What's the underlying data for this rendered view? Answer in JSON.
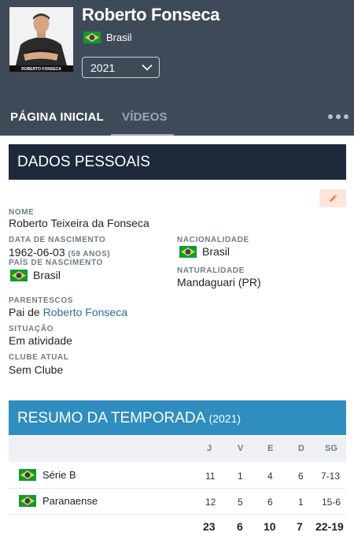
{
  "profile": {
    "name": "Roberto Fonseca",
    "country": "Brasil",
    "photo_caption": "ROBERTO FONSECA",
    "season_select": "2021"
  },
  "tabs": [
    {
      "label": "PÁGINA INICIAL",
      "active": true
    },
    {
      "label": "VÍDEOS",
      "active": false
    }
  ],
  "personal": {
    "section_title": "DADOS PESSOAIS",
    "name_label": "NOME",
    "name_value": "Roberto Teixeira da Fonseca",
    "birth_label": "DATA DE NASCIMENTO",
    "birth_value": "1962-06-03",
    "age_value": "(59 ANOS)",
    "nationality_label": "NACIONALIDADE",
    "nationality_value": "Brasil",
    "birth_country_label": "PAÍS DE NASCIMENTO",
    "birth_country_value": "Brasil",
    "birthplace_label": "NATURALIDADE",
    "birthplace_value": "Mandaguari (PR)",
    "relatives_label": "PARENTESCOS",
    "relatives_prefix": "Pai de ",
    "relatives_link": "Roberto Fonseca",
    "status_label": "SITUAÇÃO",
    "status_value": "Em atividade",
    "club_label": "CLUBE ATUAL",
    "club_value": "Sem Clube"
  },
  "season": {
    "section_title": "RESUMO DA TEMPORADA",
    "year": "(2021)",
    "columns": [
      "J",
      "V",
      "E",
      "D",
      "SG"
    ],
    "rows": [
      {
        "competition": "Série B",
        "J": "11",
        "V": "1",
        "E": "4",
        "D": "6",
        "SG": "7-13"
      },
      {
        "competition": "Paranaense",
        "J": "12",
        "V": "5",
        "E": "6",
        "D": "1",
        "SG": "15-6"
      }
    ],
    "totals": {
      "J": "23",
      "V": "6",
      "E": "10",
      "D": "7",
      "SG": "22-19"
    }
  },
  "colors": {
    "header_bg": "#3e4a57",
    "dark_section": "#1e2a3a",
    "blue_section": "#2f8dc0",
    "link": "#2b6e9e"
  },
  "icons": {
    "flag": "brazil-flag-icon",
    "dropdown": "chevron-down-icon",
    "edit": "pencil-icon",
    "more": "more-dots-icon"
  }
}
